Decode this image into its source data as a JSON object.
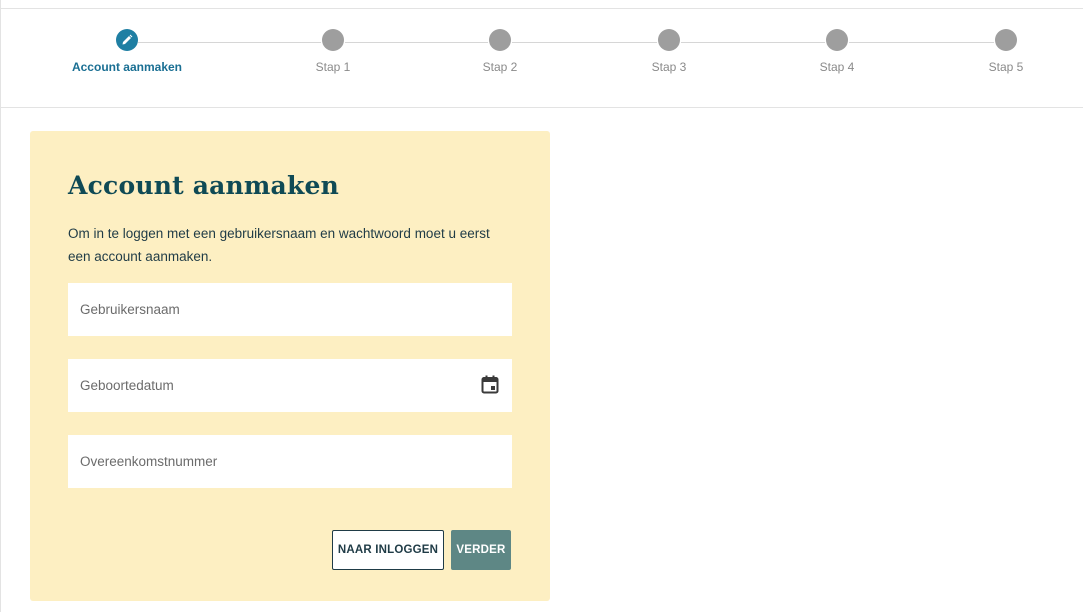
{
  "stepper": {
    "steps": [
      {
        "label": "Account aanmaken",
        "state": "active",
        "icon": "pencil-icon"
      },
      {
        "label": "Stap 1",
        "state": "inactive"
      },
      {
        "label": "Stap 2",
        "state": "inactive"
      },
      {
        "label": "Stap 3",
        "state": "inactive"
      },
      {
        "label": "Stap 4",
        "state": "inactive"
      },
      {
        "label": "Stap 5",
        "state": "inactive"
      }
    ],
    "colors": {
      "active": "#1f7fa3",
      "inactive": "#9e9e9e"
    }
  },
  "form": {
    "title": "Account aanmaken",
    "intro": "Om in te loggen met een gebruikersnaam en wachtwoord moet u eerst een account aanmaken.",
    "username": {
      "placeholder": "Gebruikersnaam",
      "value": ""
    },
    "birthdate": {
      "placeholder": "Geboortedatum",
      "value": "",
      "icon": "calendar-icon"
    },
    "agreement": {
      "placeholder": "Overeenkomstnummer",
      "value": ""
    },
    "buttons": {
      "to_login": "NAAR INLOGGEN",
      "next": "VERDER"
    },
    "colors": {
      "card_background": "#fdefc2",
      "primary_button": "#5e8785",
      "title": "#0f4a55"
    }
  }
}
